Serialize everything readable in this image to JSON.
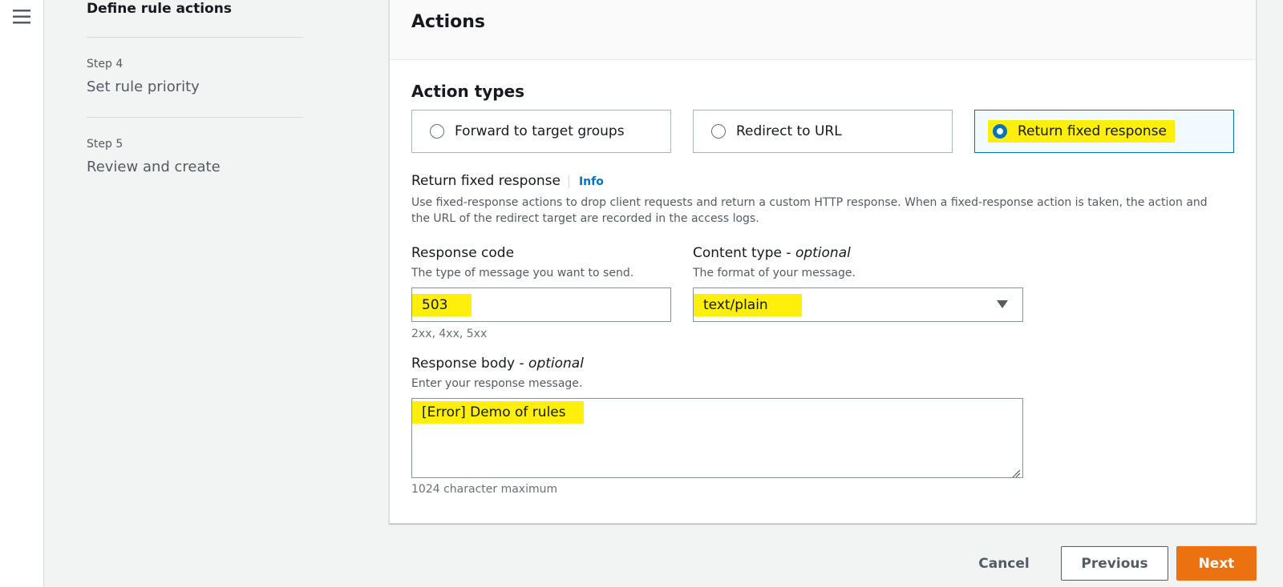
{
  "steps": {
    "current": "Define rule actions",
    "items": [
      {
        "num": "Step 4",
        "title": "Set rule priority"
      },
      {
        "num": "Step 5",
        "title": "Review and create"
      }
    ]
  },
  "panel": {
    "title": "Actions",
    "section_title": "Action types",
    "action_types": [
      {
        "label": "Forward to target groups",
        "selected": false
      },
      {
        "label": "Redirect to URL",
        "selected": false
      },
      {
        "label": "Return fixed response",
        "selected": true
      }
    ],
    "fixed_response": {
      "label": "Return fixed response",
      "info": "Info",
      "description": "Use fixed-response actions to drop client requests and return a custom HTTP response. When a fixed-response action is taken, the action and the URL of the redirect target are recorded in the access logs."
    },
    "response_code": {
      "label": "Response code",
      "description": "The type of message you want to send.",
      "value": "503",
      "constraint": "2xx, 4xx, 5xx"
    },
    "content_type": {
      "label": "Content type -",
      "optional": "optional",
      "description": "The format of your message.",
      "value": "text/plain"
    },
    "response_body": {
      "label": "Response body -",
      "optional": "optional",
      "description": "Enter your response message.",
      "value": "[Error] Demo of rules",
      "constraint": "1024 character maximum"
    }
  },
  "footer": {
    "cancel": "Cancel",
    "previous": "Previous",
    "next": "Next"
  },
  "colors": {
    "accent": "#0073bb",
    "highlight": "#ffef0a",
    "primary_button": "#ec7211"
  }
}
